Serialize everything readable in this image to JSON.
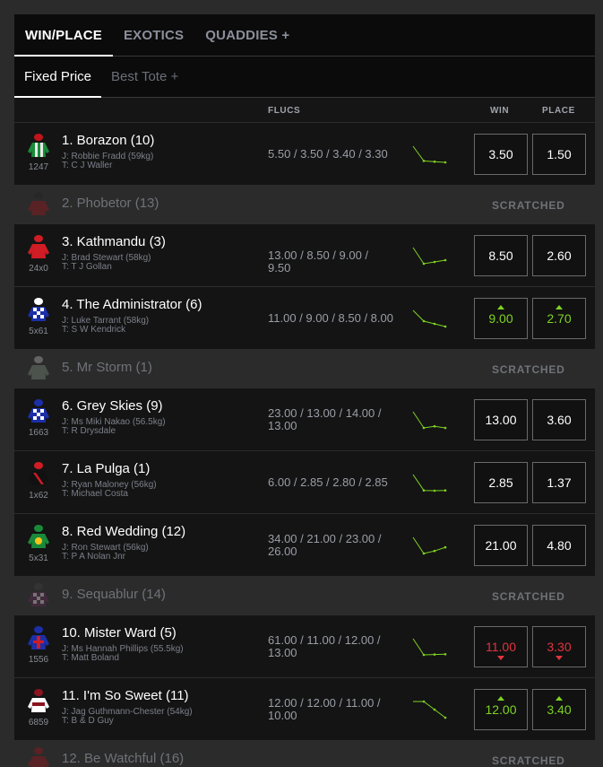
{
  "tabs": [
    "WIN/PLACE",
    "EXOTICS",
    "QUADDIES +"
  ],
  "subtabs": [
    "Fixed Price",
    "Best Tote +"
  ],
  "columns": {
    "flucs": "FLUCS",
    "win": "WIN",
    "place": "PLACE"
  },
  "scratched_label": "SCRATCHED",
  "colors": {
    "up": "#7ed321",
    "down": "#e0343f",
    "background": "#191919",
    "scratched_row": "#2b2b2b"
  },
  "runners": [
    {
      "name": "1. Borazon (10)",
      "form": "1247",
      "jockey": "J: Robbie Fradd (59kg)",
      "trainer": "T: C J Waller",
      "flucs": "5.50 / 3.50 / 3.40 / 3.30",
      "fluc_values": [
        5.5,
        3.5,
        3.4,
        3.3
      ],
      "win": "3.50",
      "place": "1.50",
      "win_trend": "none",
      "place_trend": "none",
      "silk": {
        "body": "#1a8a3a",
        "stripe": "#e8e8e8",
        "pattern": "stripes",
        "cap": "#c0141c"
      }
    },
    {
      "name": "2. Phobetor (13)",
      "scratched": true,
      "silk": {
        "body": "#b0141c",
        "stripe": "#222222",
        "pattern": "plain",
        "cap": "#222222"
      }
    },
    {
      "name": "3. Kathmandu (3)",
      "form": "24x0",
      "jockey": "J: Brad Stewart (58kg)",
      "trainer": "T: T J Gollan",
      "flucs": "13.00 / 8.50 / 9.00 / 9.50",
      "fluc_values": [
        13.0,
        8.5,
        9.0,
        9.5
      ],
      "win": "8.50",
      "place": "2.60",
      "win_trend": "none",
      "place_trend": "none",
      "silk": {
        "body": "#d01c24",
        "stripe": "#f5c518",
        "pattern": "plain",
        "cap": "#d01c24"
      }
    },
    {
      "name": "4. The Administrator (6)",
      "form": "5x61",
      "jockey": "J: Luke Tarrant (58kg)",
      "trainer": "T: S W Kendrick",
      "flucs": "11.00 / 9.00 / 8.50 / 8.00",
      "fluc_values": [
        11.0,
        9.0,
        8.5,
        8.0
      ],
      "win": "9.00",
      "place": "2.70",
      "win_trend": "up",
      "place_trend": "up",
      "silk": {
        "body": "#1c2fa8",
        "stripe": "#ffffff",
        "pattern": "checks",
        "cap": "#ffffff"
      }
    },
    {
      "name": "5. Mr Storm (1)",
      "scratched": true,
      "silk": {
        "body": "#8a9a8a",
        "stripe": "#ffffff",
        "pattern": "plain",
        "cap": "#cccccc"
      }
    },
    {
      "name": "6. Grey Skies (9)",
      "form": "1663",
      "jockey": "J: Ms Miki Nakao (56.5kg)",
      "trainer": "T: R Drysdale",
      "flucs": "23.00 / 13.00 / 14.00 / 13.00",
      "fluc_values": [
        23.0,
        13.0,
        14.0,
        13.0
      ],
      "win": "13.00",
      "place": "3.60",
      "win_trend": "none",
      "place_trend": "none",
      "silk": {
        "body": "#1c2fa8",
        "stripe": "#ffffff",
        "pattern": "checks",
        "cap": "#1c2fa8"
      }
    },
    {
      "name": "7. La Pulga (1)",
      "form": "1x62",
      "jockey": "J: Ryan Maloney (56kg)",
      "trainer": "T: Michael Costa",
      "flucs": "6.00 / 2.85 / 2.80 / 2.85",
      "fluc_values": [
        6.0,
        2.85,
        2.8,
        2.85
      ],
      "win": "2.85",
      "place": "1.37",
      "win_trend": "none",
      "place_trend": "none",
      "silk": {
        "body": "#111111",
        "stripe": "#d01c24",
        "pattern": "sash",
        "cap": "#d01c24"
      }
    },
    {
      "name": "8. Red Wedding (12)",
      "form": "5x31",
      "jockey": "J: Ron Stewart (56kg)",
      "trainer": "T: P A Nolan Jnr",
      "flucs": "34.00 / 21.00 / 23.00 / 26.00",
      "fluc_values": [
        34.0,
        21.0,
        23.0,
        26.0
      ],
      "win": "21.00",
      "place": "4.80",
      "win_trend": "none",
      "place_trend": "none",
      "silk": {
        "body": "#1a8a3a",
        "stripe": "#f5c518",
        "pattern": "circle",
        "cap": "#1a8a3a"
      }
    },
    {
      "name": "9. Sequablur (14)",
      "scratched": true,
      "silk": {
        "body": "#6a2a5a",
        "stripe": "#ffffff",
        "pattern": "checks",
        "cap": "#444444"
      }
    },
    {
      "name": "10. Mister Ward (5)",
      "form": "1556",
      "jockey": "J: Ms Hannah Phillips (55.5kg)",
      "trainer": "T: Matt Boland",
      "flucs": "61.00 / 11.00 / 12.00 / 13.00",
      "fluc_values": [
        61.0,
        11.0,
        12.0,
        13.0
      ],
      "win": "11.00",
      "place": "3.30",
      "win_trend": "down",
      "place_trend": "down",
      "silk": {
        "body": "#1c2fa8",
        "stripe": "#d01c24",
        "pattern": "cross",
        "cap": "#1c2fa8"
      }
    },
    {
      "name": "11. I'm So Sweet (11)",
      "form": "6859",
      "jockey": "J: Jag Guthmann-Chester (54kg)",
      "trainer": "T: B & D Guy",
      "flucs": "12.00 / 12.00 / 11.00 / 10.00",
      "fluc_values": [
        12.0,
        12.0,
        11.0,
        10.0
      ],
      "win": "12.00",
      "place": "3.40",
      "win_trend": "up",
      "place_trend": "up",
      "silk": {
        "body": "#ffffff",
        "stripe": "#8a1420",
        "pattern": "band",
        "cap": "#8a1420"
      }
    },
    {
      "name": "12. Be Watchful (16)",
      "scratched": true,
      "silk": {
        "body": "#b0141c",
        "stripe": "#ffffff",
        "pattern": "plain",
        "cap": "#b0141c"
      }
    }
  ]
}
